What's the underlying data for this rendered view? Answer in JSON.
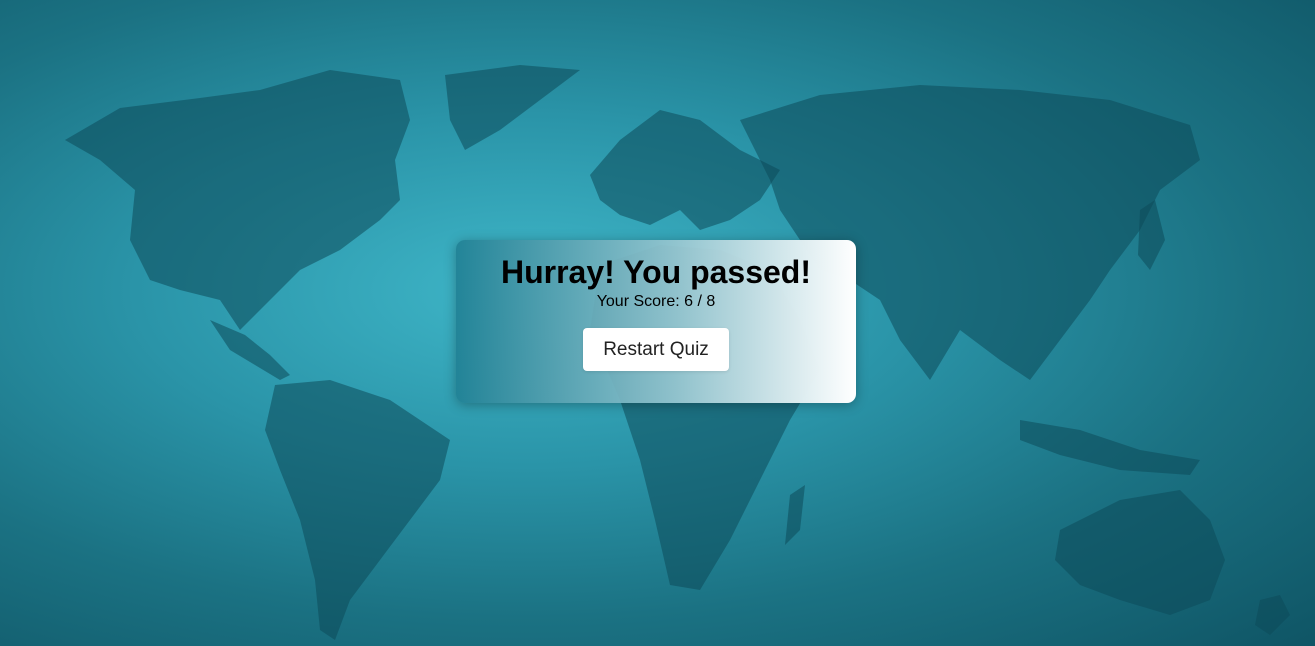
{
  "result": {
    "title": "Hurray! You passed!",
    "score_label": "Your Score:",
    "score": 6,
    "total": 8,
    "score_text": "6 / 8",
    "restart_label": "Restart Quiz"
  },
  "colors": {
    "background": "#2a94a8",
    "land": "#0d4a5a",
    "button_bg": "#ffffff"
  }
}
